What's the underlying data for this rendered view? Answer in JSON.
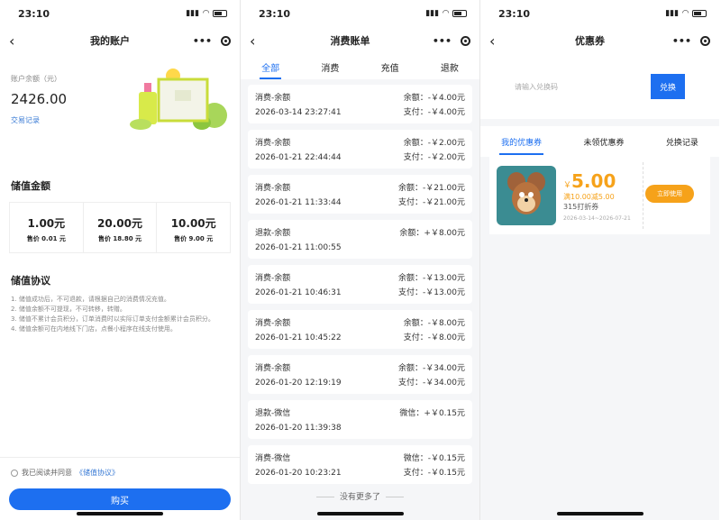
{
  "time": "23:10",
  "panel1": {
    "title": "我的账户",
    "balance_label": "账户余额（元）",
    "balance": "2426.00",
    "records_link": "交易记录",
    "stored_value_title": "储值金额",
    "cards": [
      {
        "amount": "1.00元",
        "price": "售价 0.01 元"
      },
      {
        "amount": "20.00元",
        "price": "售价 18.80 元"
      },
      {
        "amount": "10.00元",
        "price": "售价 9.00 元"
      }
    ],
    "agreement_title": "储值协议",
    "terms": [
      "1. 储值成功后，不可退款，请根据自己的消费情况充值。",
      "2. 储值余额不可提现，不可转移，转赠。",
      "3. 储值不累计会员积分，订单消费时以实际订单支付金额累计会员积分。",
      "4. 储值余额可在内地线下门店，点餐小程序在线支付使用。"
    ],
    "agree_text": "我已阅读并同意",
    "agree_link": "《储值协议》",
    "buy_label": "购买"
  },
  "panel2": {
    "title": "消费账单",
    "tabs": [
      "全部",
      "消费",
      "充值",
      "退款"
    ],
    "items": [
      {
        "type": "消费-余额",
        "time": "2026-03-14 23:27:41",
        "lines": [
          "余额：-￥4.00元",
          "支付：-￥4.00元"
        ]
      },
      {
        "type": "消费-余额",
        "time": "2026-01-21 22:44:44",
        "lines": [
          "余额：-￥2.00元",
          "支付：-￥2.00元"
        ]
      },
      {
        "type": "消费-余额",
        "time": "2026-01-21 11:33:44",
        "lines": [
          "余额：-￥21.00元",
          "支付：-￥21.00元"
        ]
      },
      {
        "type": "退款-余额",
        "time": "2026-01-21 11:00:55",
        "lines": [
          "余额：+￥8.00元"
        ]
      },
      {
        "type": "消费-余额",
        "time": "2026-01-21 10:46:31",
        "lines": [
          "余额：-￥13.00元",
          "支付：-￥13.00元"
        ]
      },
      {
        "type": "消费-余额",
        "time": "2026-01-21 10:45:22",
        "lines": [
          "余额：-￥8.00元",
          "支付：-￥8.00元"
        ]
      },
      {
        "type": "消费-余额",
        "time": "2026-01-20 12:19:19",
        "lines": [
          "余额：-￥34.00元",
          "支付：-￥34.00元"
        ]
      },
      {
        "type": "退款-微信",
        "time": "2026-01-20 11:39:38",
        "lines": [
          "微信：+￥0.15元"
        ]
      },
      {
        "type": "消费-微信",
        "time": "2026-01-20 10:23:21",
        "lines": [
          "微信：-￥0.15元",
          "支付：-￥0.15元"
        ]
      }
    ],
    "no_more": "没有更多了"
  },
  "panel3": {
    "title": "优惠券",
    "redeem_placeholder": "请输入兑换码",
    "redeem_button": "兑换",
    "tabs": [
      "我的优惠券",
      "未领优惠券",
      "兑换记录"
    ],
    "coupon": {
      "currency": "￥",
      "value": "5.00",
      "condition": "满10.00减5.00",
      "name": "315打折券",
      "date": "2026-03-14~2026-07-21",
      "use_label": "立即使用"
    }
  },
  "colors": {
    "accent": "#1d6ff0",
    "coupon": "#f6a21a"
  }
}
